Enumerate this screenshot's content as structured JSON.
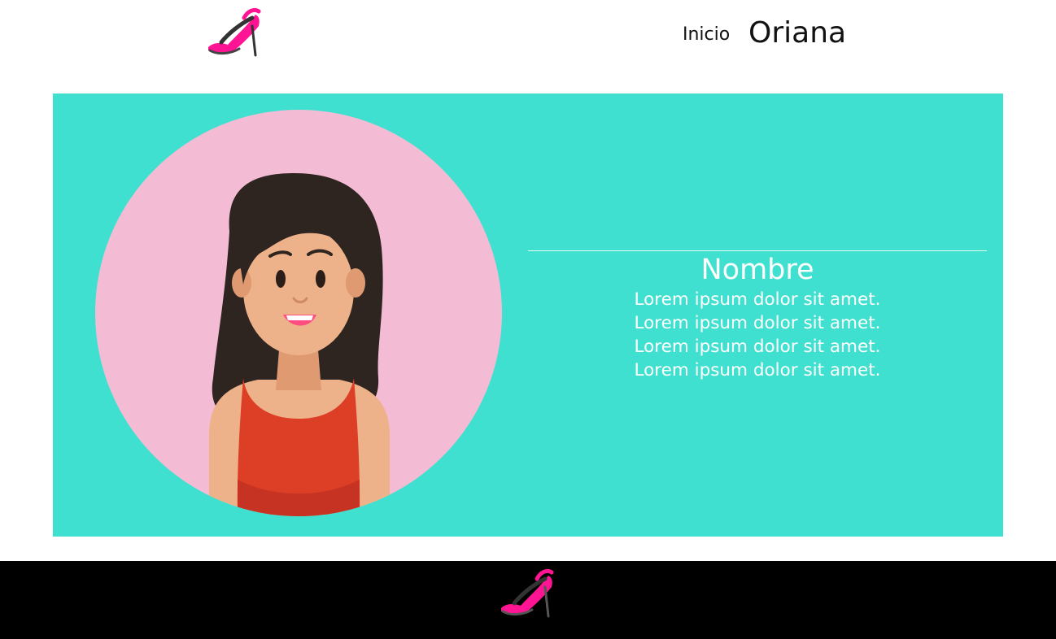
{
  "colors": {
    "card_background": "#40e0d0",
    "avatar_circle": "#f4bcd4",
    "logo_pink": "#ff1493",
    "footer_background": "#000000",
    "text_on_card": "#ffffff"
  },
  "header": {
    "logo_icon": "high-heel-shoe-logo",
    "nav_link": "Inicio",
    "brand_name": "Oriana"
  },
  "profile": {
    "avatar_icon": "woman-avatar-illustration",
    "name": "Nombre",
    "lines": [
      "Lorem ipsum dolor sit amet.",
      "Lorem ipsum dolor sit amet.",
      "Lorem ipsum dolor sit amet.",
      "Lorem ipsum dolor sit amet."
    ]
  },
  "footer": {
    "logo_icon": "high-heel-shoe-logo"
  }
}
